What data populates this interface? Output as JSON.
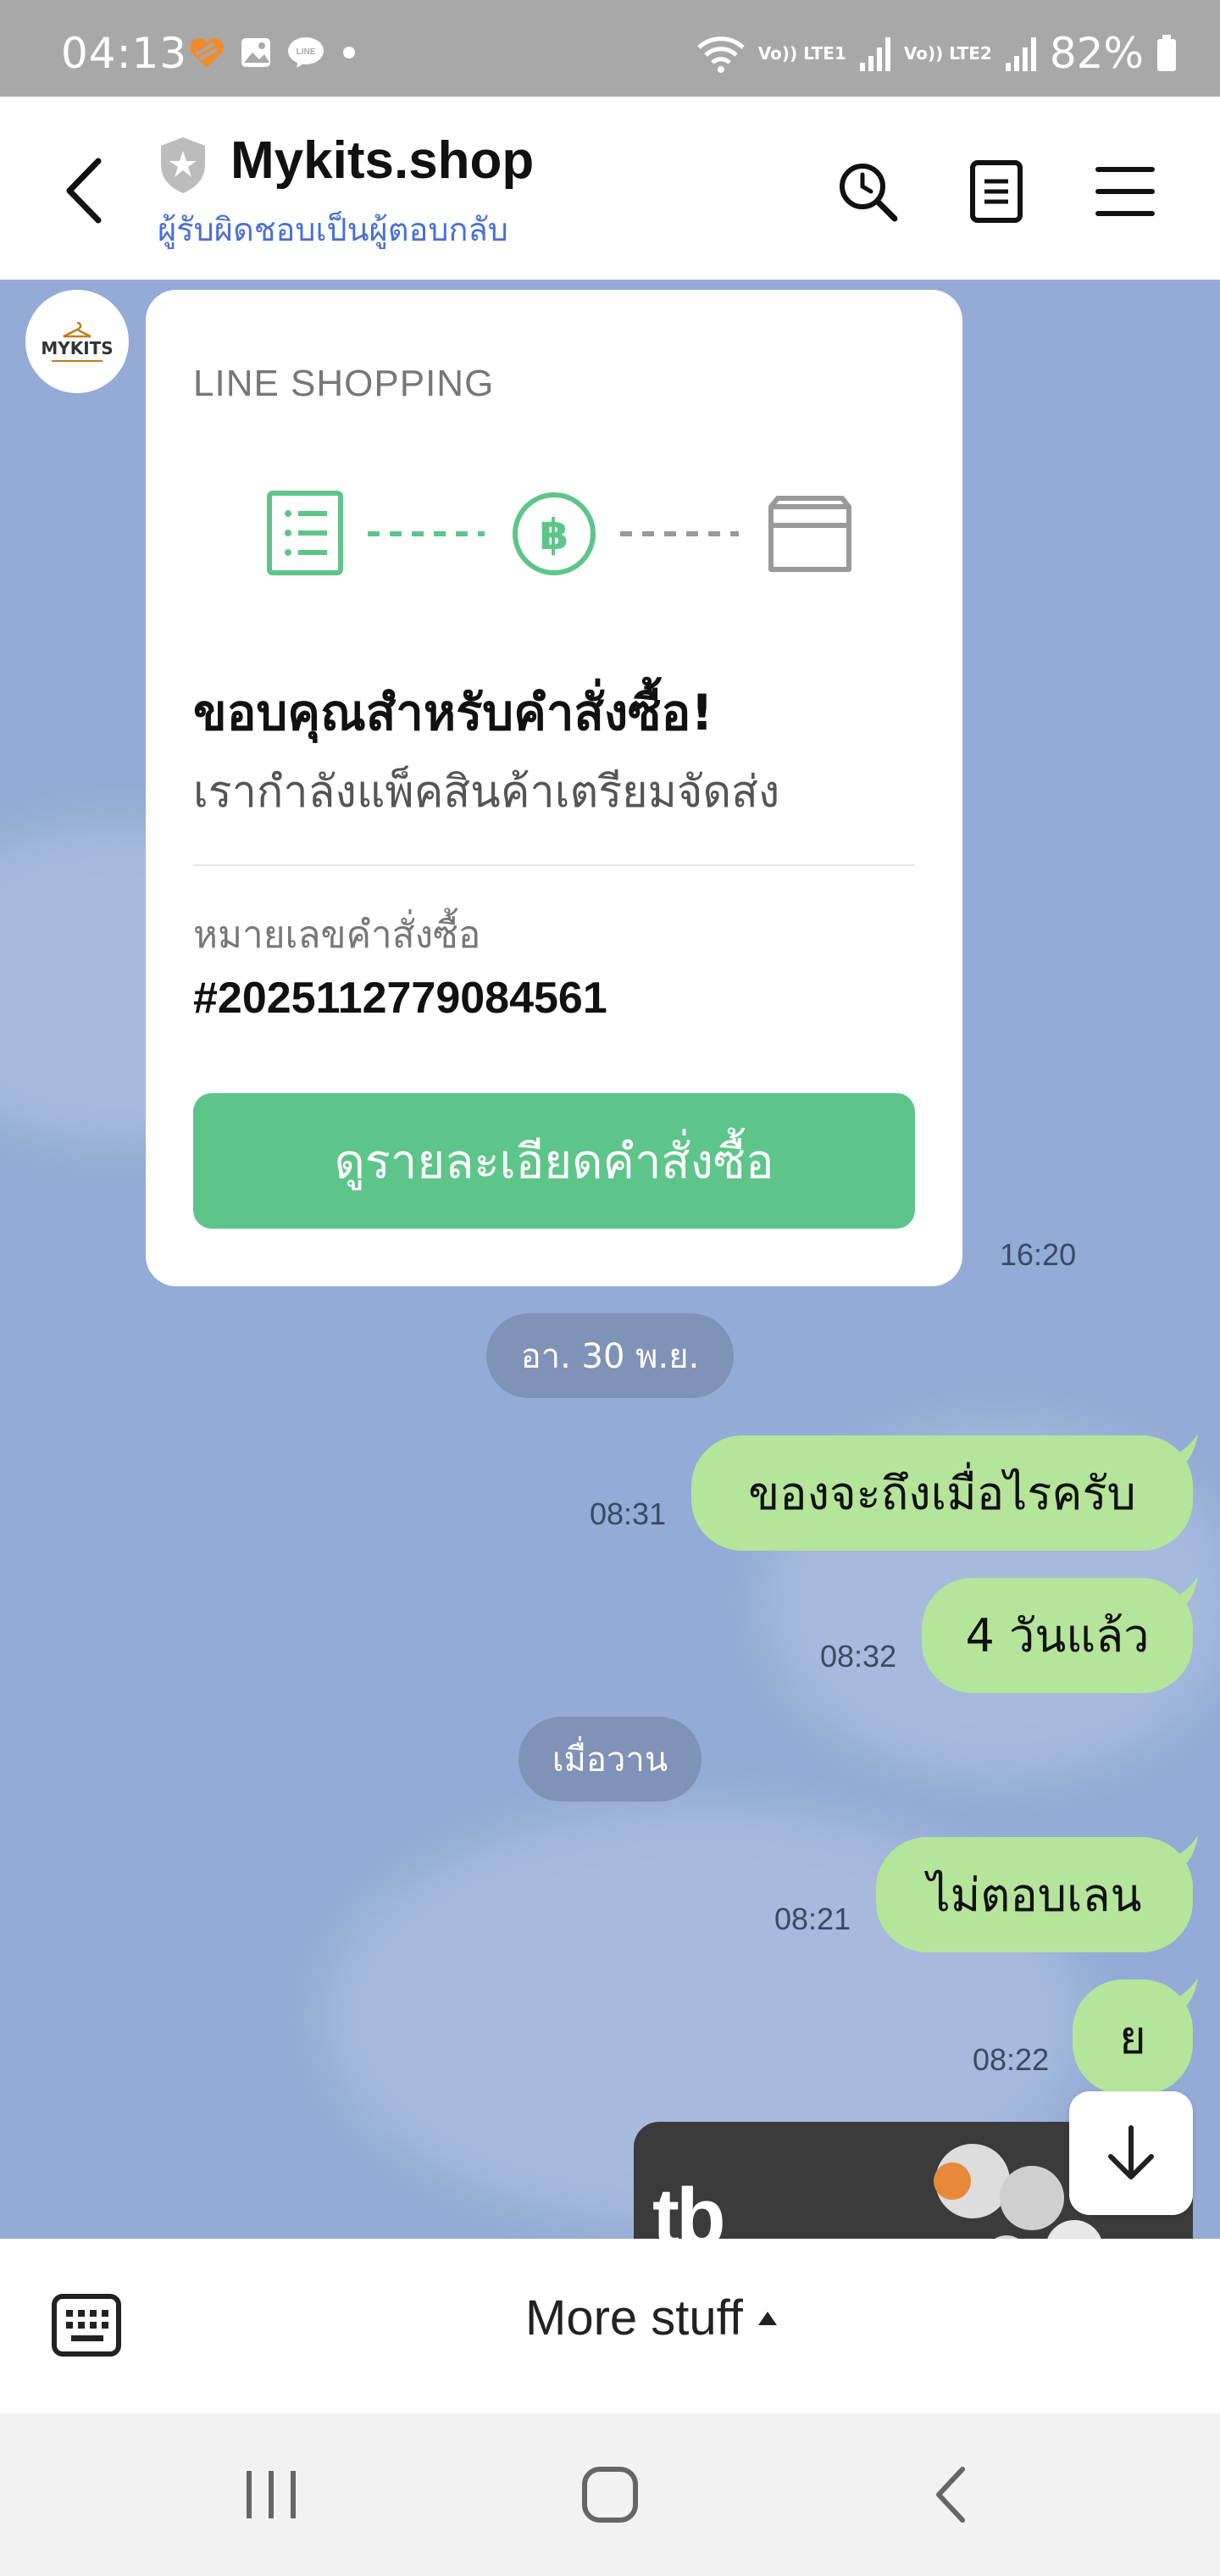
{
  "status_bar": {
    "time": "04:13",
    "notification_icons": [
      "heart-app-icon",
      "gallery-icon",
      "line-icon",
      "dot-icon"
    ],
    "lte1_label": "Vo)) LTE1",
    "lte2_label": "Vo)) LTE2",
    "battery": "82%"
  },
  "header": {
    "title": "Mykits.shop",
    "subtitle": "ผู้รับผิดชอบเป็นผู้ตอบกลับ"
  },
  "chat": {
    "avatar_text": "MYKITS",
    "order_card": {
      "brand": "LINE SHOPPING",
      "heading": "ขอบคุณสำหรับคำสั่งซื้อ!",
      "status": "เรากำลังแพ็คสินค้าเตรียมจัดส่ง",
      "order_label": "หมายเลขคำสั่งซื้อ",
      "order_number": "#2025112779084561",
      "button_label": "ดูรายละเอียดคำสั่งซื้อ",
      "time": "16:20"
    },
    "date_separator_1": "อา. 30 พ.ย.",
    "messages_1": [
      {
        "text": "ของจะถึงเมื่อไรครับ",
        "time": "08:31"
      },
      {
        "text": "4 วันแล้ว",
        "time": "08:32"
      }
    ],
    "date_separator_2": "เมื่อวาน",
    "messages_2": [
      {
        "text": "ไม่ตอบเลน",
        "time": "08:21"
      },
      {
        "text": "ย",
        "time": "08:22"
      }
    ],
    "media_logo": "tb"
  },
  "bottom_bar": {
    "more_label": "More stuff"
  },
  "colors": {
    "chat_bg": "#93abd6",
    "bubble": "#b4e59a",
    "accent_green": "#5ec58a",
    "link_blue": "#4a6fd8"
  }
}
